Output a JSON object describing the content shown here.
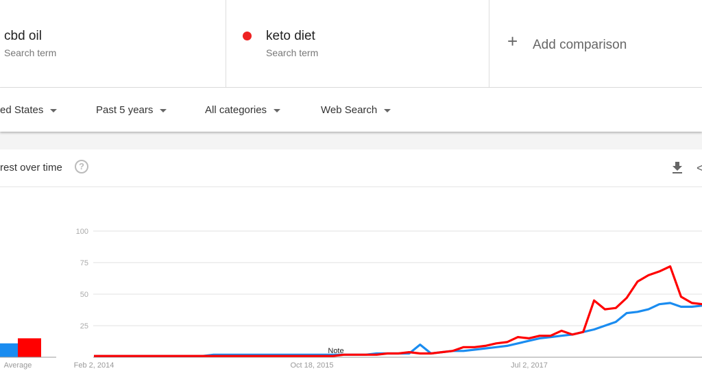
{
  "terms": [
    {
      "name": "cbd oil",
      "sub": "Search term",
      "color": "#1a8cf0"
    },
    {
      "name": "keto diet",
      "sub": "Search term",
      "color": "#ee2222"
    }
  ],
  "add_comparison": {
    "icon": "plus-icon",
    "label": "Add comparison"
  },
  "filters": [
    {
      "label": "ed States"
    },
    {
      "label": "Past 5 years"
    },
    {
      "label": "All categories"
    },
    {
      "label": "Web Search"
    }
  ],
  "card": {
    "title": "rest over time",
    "help_icon": "?",
    "download_icon": "download-icon",
    "share_icon": "share-icon"
  },
  "chart_data": {
    "type": "line",
    "ylim": [
      0,
      100
    ],
    "yticks": [
      "25",
      "50",
      "75",
      "100"
    ],
    "xticks": [
      "Feb 2, 2014",
      "Oct 18, 2015",
      "Jul 2, 2017"
    ],
    "grid": true,
    "annotation": "Note",
    "average_label": "Average",
    "averages": {
      "cbd oil": 11,
      "keto diet": 15
    },
    "x": [
      "2014-02",
      "2014-03",
      "2014-04",
      "2014-05",
      "2014-06",
      "2014-07",
      "2014-08",
      "2014-09",
      "2014-10",
      "2014-11",
      "2014-12",
      "2015-01",
      "2015-02",
      "2015-03",
      "2015-04",
      "2015-05",
      "2015-06",
      "2015-07",
      "2015-08",
      "2015-09",
      "2015-10",
      "2015-11",
      "2015-12",
      "2016-01",
      "2016-02",
      "2016-03",
      "2016-04",
      "2016-05",
      "2016-06",
      "2016-07",
      "2016-08",
      "2016-09",
      "2016-10",
      "2016-11",
      "2016-12",
      "2017-01",
      "2017-02",
      "2017-03",
      "2017-04",
      "2017-05",
      "2017-06",
      "2017-07",
      "2017-08",
      "2017-09",
      "2017-10",
      "2017-11",
      "2017-12",
      "2018-01",
      "2018-02",
      "2018-03",
      "2018-04",
      "2018-05",
      "2018-06",
      "2018-07",
      "2018-08",
      "2018-09",
      "2018-10"
    ],
    "series": [
      {
        "name": "cbd oil",
        "color": "#1a8cf0",
        "values": [
          1,
          1,
          1,
          1,
          1,
          1,
          1,
          1,
          1,
          1,
          1,
          2,
          2,
          2,
          2,
          2,
          2,
          2,
          2,
          2,
          2,
          2,
          2,
          2,
          2,
          2,
          3,
          3,
          3,
          3,
          10,
          3,
          4,
          5,
          5,
          6,
          7,
          8,
          9,
          11,
          13,
          15,
          16,
          17,
          18,
          20,
          22,
          25,
          28,
          35,
          36,
          38,
          42,
          43,
          40,
          40,
          41
        ]
      },
      {
        "name": "keto diet",
        "color": "#ff0000",
        "values": [
          1,
          1,
          1,
          1,
          1,
          1,
          1,
          1,
          1,
          1,
          1,
          1,
          1,
          1,
          1,
          1,
          1,
          1,
          1,
          1,
          1,
          1,
          1,
          2,
          2,
          2,
          2,
          3,
          3,
          4,
          3,
          3,
          4,
          5,
          8,
          8,
          9,
          11,
          12,
          16,
          15,
          17,
          17,
          21,
          18,
          20,
          45,
          38,
          39,
          47,
          60,
          65,
          68,
          72,
          48,
          43,
          42
        ]
      }
    ]
  }
}
